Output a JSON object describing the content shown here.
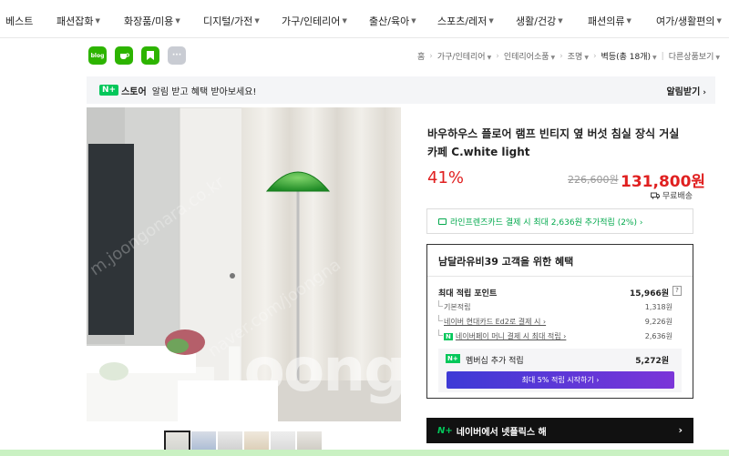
{
  "topnav": [
    {
      "label": "베스트",
      "chev": false
    },
    {
      "label": "패션잡화",
      "chev": true
    },
    {
      "label": "화장품/미용",
      "chev": true
    },
    {
      "label": "디지털/가전",
      "chev": true
    },
    {
      "label": "가구/인테리어",
      "chev": true
    },
    {
      "label": "출산/육아",
      "chev": true
    },
    {
      "label": "스포츠/레저",
      "chev": true
    },
    {
      "label": "생활/건강",
      "chev": true
    },
    {
      "label": "패션의류",
      "chev": true
    },
    {
      "label": "여가/생활편의",
      "chev": true
    }
  ],
  "share": {
    "blog": "blog",
    "more": "···"
  },
  "breadcrumb": {
    "home": "홈",
    "items": [
      "가구/인테리어",
      "인테리어소품",
      "조명",
      "벽등(총 18개)",
      "다른상품보기"
    ]
  },
  "store": {
    "badge": "N+",
    "name": "스토어",
    "message": "알림 받고 혜택 받아보세요!",
    "button": "알림받기"
  },
  "watermark": {
    "main": "Joongg",
    "diag1": "m.joongonara.co.kr",
    "diag2": "naver.com/joongna"
  },
  "product": {
    "title": "바우하우스 플로어 램프 빈티지 옆 버섯 침실 장식 거실 카페 C.white light",
    "discount": "41%",
    "original_price": "226,600원",
    "price": "131,800원",
    "shipping": "무료배송"
  },
  "card_offer": "라인프렌즈카드 결제 시 최대 2,636원 추가적립 (2%) ›",
  "benefit": {
    "heading": "남달라유비39 고객을 위한 혜택",
    "max_label": "최대 적립 포인트",
    "max_value": "15,966원",
    "help": "?",
    "rows": [
      {
        "label": "기본적립",
        "value": "1,318원"
      },
      {
        "label": "네이버 현대카드 Ed2로 결제 시 ›",
        "value": "9,226원"
      },
      {
        "badge": "N",
        "label": "네이버페이 머니 결제 시 최대 적립 ›",
        "value": "2,636원"
      }
    ],
    "member": {
      "badge": "N+",
      "label": "멤버십 추가 적립",
      "value": "5,272원",
      "button": "최대 5% 적립 시작하기 ›"
    }
  },
  "netflix": {
    "logo": "N+",
    "text": "네이버에서 넷플릭스 해",
    "chev": "›"
  },
  "colors": {
    "accent_green": "#03c75a",
    "price_red": "#e02020",
    "purple": "#6d36d8"
  }
}
